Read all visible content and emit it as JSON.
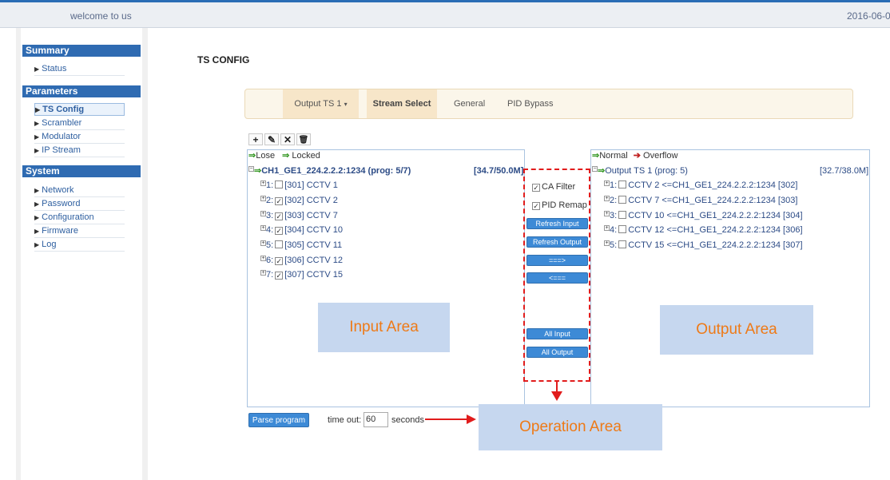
{
  "header": {
    "welcome": "welcome to us",
    "date": "2016-06-0"
  },
  "sidebar": {
    "summary": {
      "title": "Summary",
      "items": [
        {
          "label": "Status"
        }
      ]
    },
    "parameters": {
      "title": "Parameters",
      "items": [
        {
          "label": "TS Config"
        },
        {
          "label": "Scrambler"
        },
        {
          "label": "Modulator"
        },
        {
          "label": "IP Stream"
        }
      ]
    },
    "system": {
      "title": "System",
      "items": [
        {
          "label": "Network"
        },
        {
          "label": "Password"
        },
        {
          "label": "Configuration"
        },
        {
          "label": "Firmware"
        },
        {
          "label": "Log"
        }
      ]
    }
  },
  "page_title": "TS CONFIG",
  "tabs": {
    "output": "Output TS 1",
    "stream": "Stream Select",
    "general": "General",
    "pid": "PID Bypass"
  },
  "toolbar": {
    "add": "+",
    "edit": "✎",
    "delete": "✕",
    "trash": "🗑"
  },
  "input_panel": {
    "legend_lose": "Lose",
    "legend_locked": "Locked",
    "channel": "CH1_GE1_224.2.2.2:1234 (prog: 5/7)",
    "rate": "[34.7/50.0M]",
    "programs": [
      {
        "num": "1:",
        "label": "[301] CCTV 1",
        "checked": false
      },
      {
        "num": "2:",
        "label": "[302] CCTV 2",
        "checked": true
      },
      {
        "num": "3:",
        "label": "[303] CCTV 7",
        "checked": true
      },
      {
        "num": "4:",
        "label": "[304] CCTV 10",
        "checked": true
      },
      {
        "num": "5:",
        "label": "[305] CCTV 11",
        "checked": false
      },
      {
        "num": "6:",
        "label": "[306] CCTV 12",
        "checked": true
      },
      {
        "num": "7:",
        "label": "[307] CCTV 15",
        "checked": true
      }
    ]
  },
  "output_panel": {
    "legend_normal": "Normal",
    "legend_overflow": "Overflow",
    "ts": "Output TS 1 (prog: 5)",
    "rate": "[32.7/38.0M]",
    "programs": [
      {
        "num": "1:",
        "label": "CCTV 2 <=CH1_GE1_224.2.2.2:1234 [302]"
      },
      {
        "num": "2:",
        "label": "CCTV 7 <=CH1_GE1_224.2.2.2:1234 [303]"
      },
      {
        "num": "3:",
        "label": "CCTV 10 <=CH1_GE1_224.2.2.2:1234 [304]"
      },
      {
        "num": "4:",
        "label": "CCTV 12 <=CH1_GE1_224.2.2.2:1234 [306]"
      },
      {
        "num": "5:",
        "label": "CCTV 15 <=CH1_GE1_224.2.2.2:1234 [307]"
      }
    ]
  },
  "operation": {
    "ca_filter": "CA Filter",
    "pid_remap": "PID Remap",
    "refresh_input": "Refresh Input",
    "refresh_output": "Refresh Output",
    "move_right": "===>",
    "move_left": "<===",
    "all_input": "All Input",
    "all_output": "All Output"
  },
  "annotations": {
    "input": "Input Area",
    "output": "Output Area",
    "operation": "Operation Area"
  },
  "bottom": {
    "parse": "Parse program",
    "timeout_label": "time out:",
    "timeout_value": "60",
    "seconds": "seconds"
  },
  "colors": {
    "nav_blue": "#2f6bb2",
    "button_blue": "#3d8ad6",
    "annotation_red": "#e11c1c",
    "annotation_orange": "#ee7a17"
  }
}
